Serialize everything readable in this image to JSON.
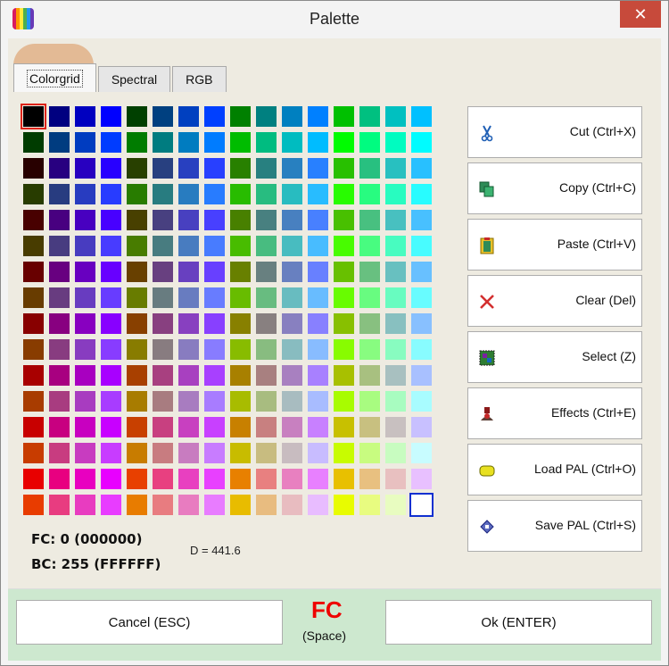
{
  "window": {
    "title": "Palette",
    "close_glyph": "✕"
  },
  "app_icon_colors": [
    "#d81b60",
    "#ff9800",
    "#ffeb3b",
    "#4caf50",
    "#2196f3",
    "#673ab7"
  ],
  "tabs": [
    {
      "label": "Colorgrid",
      "active": true
    },
    {
      "label": "Spectral",
      "active": false
    },
    {
      "label": "RGB",
      "active": false
    }
  ],
  "grid": {
    "rows": 16,
    "cols": 16,
    "selected_fc": 0,
    "selected_bc": 255
  },
  "status": {
    "fc": "FC: 0 (000000)",
    "bc": "BC: 255 (FFFFFF)",
    "distance": "D = 441.6"
  },
  "actions": [
    {
      "label": "Cut (Ctrl+X)",
      "icon": "scissors-icon"
    },
    {
      "label": "Copy (Ctrl+C)",
      "icon": "copy-icon"
    },
    {
      "label": "Paste (Ctrl+V)",
      "icon": "paste-icon"
    },
    {
      "label": "Clear (Del)",
      "icon": "clear-icon"
    },
    {
      "label": "Select (Z)",
      "icon": "select-icon"
    },
    {
      "label": "Effects (Ctrl+E)",
      "icon": "effects-icon"
    },
    {
      "label": "Load PAL (Ctrl+O)",
      "icon": "load-icon"
    },
    {
      "label": "Save PAL (Ctrl+S)",
      "icon": "save-icon"
    }
  ],
  "footer": {
    "cancel": "Cancel (ESC)",
    "ok": "Ok (ENTER)",
    "indicator": "FC",
    "indicator_hint": "(Space)"
  }
}
